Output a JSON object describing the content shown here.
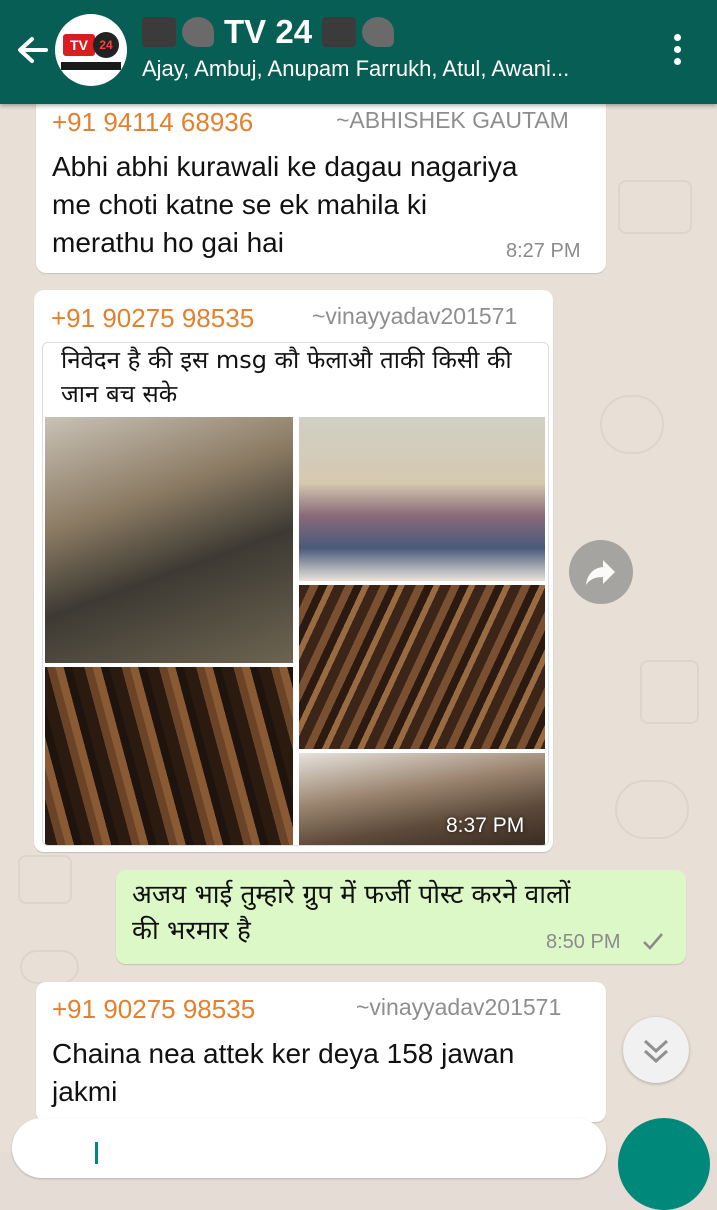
{
  "header": {
    "title": "TV 24",
    "subtitle": "Ajay, Ambuj, Anupam Farrukh, Atul, Awani...",
    "avatar_logo_text": "TV",
    "avatar_logo_num": "24",
    "icons": [
      "back-arrow-icon",
      "movie-camera-icon",
      "satellite-dish-icon",
      "radio-icon",
      "more-vert-icon"
    ]
  },
  "messages": [
    {
      "sender": "+91 94114 68936",
      "alias": "~ABHISHEK GAUTAM",
      "lines": [
        "Abhi abhi kurawali ke dagau nagariya",
        "me choti katne se ek mahila ki",
        "merathu ho gai hai"
      ],
      "time": "8:27 PM"
    },
    {
      "sender": "+91 90275 98535",
      "alias": "~vinayyadav201571",
      "image_caption_lines": [
        "निवेदन है की इस msg कौ फेलाऔ ताकी किसी की",
        "जान बच सके"
      ],
      "time": "8:37 PM"
    },
    {
      "outgoing": true,
      "lines": [
        "अजय भाई तुम्हारे ग्रुप में फर्जी पोस्ट करने वालों",
        "की भरमार है"
      ],
      "time": "8:50 PM"
    },
    {
      "sender": "+91 90275 98535",
      "alias": "~vinayyadav201571",
      "lines": [
        "Chaina nea attek ker deya 158 jawan",
        "jakmi"
      ]
    }
  ],
  "colors": {
    "header": "#075e54",
    "sender": "#e3802f",
    "outgoing_bubble": "#dcf8c6",
    "accent": "#00897b"
  }
}
